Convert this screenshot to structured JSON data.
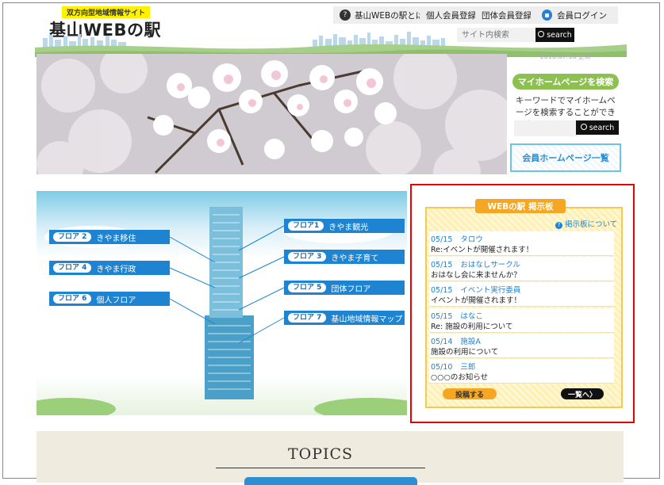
{
  "header": {
    "tagline": "双方向型地域情報サイト",
    "logo": "基山WEBの駅",
    "nav": {
      "about": "基山WEBの駅とは",
      "personal": "個人会員登録",
      "group": "団体会員登録",
      "login": "会員ログイン"
    },
    "search": {
      "placeholder": "サイト内検索",
      "button": "search"
    }
  },
  "sidebar": {
    "date": "2018.07.16 更新",
    "mypage_title": "マイホームページを検索",
    "mypage_desc": "キーワードでマイホームページを検索することができます",
    "mypage_button": "search",
    "member_list": "会員ホームページ一覧"
  },
  "floors": [
    {
      "tag": "フロア 2",
      "label": "きやま移住"
    },
    {
      "tag": "フロア 4",
      "label": "きやま行政"
    },
    {
      "tag": "フロア 6",
      "label": "個人フロア"
    },
    {
      "tag": "フロア1",
      "label": "きやま観光"
    },
    {
      "tag": "フロア 3",
      "label": "きやま子育て"
    },
    {
      "tag": "フロア 5",
      "label": "団体フロア"
    },
    {
      "tag": "フロア 7",
      "label": "基山地域情報マップ"
    }
  ],
  "board": {
    "title": "WEBの駅 掲示板",
    "about": "掲示板について",
    "posts": [
      {
        "date": "05/15",
        "author": "タロウ",
        "text": "Re:イベントが開催されます！"
      },
      {
        "date": "05/15",
        "author": "おはなしサークル",
        "text": "おはなし会に来ませんか？"
      },
      {
        "date": "05/15",
        "author": "イベント実行委員",
        "text": "イベントが開催されます！"
      },
      {
        "date": "05/15",
        "author": "はなこ",
        "text": "Re: 施設の利用について"
      },
      {
        "date": "05/14",
        "author": "施設A",
        "text": "施設の利用について"
      },
      {
        "date": "05/10",
        "author": "三郎",
        "text": "○○○のお知らせ"
      }
    ],
    "post_button": "投稿する",
    "list_button": "一覧へ〉"
  },
  "topics": {
    "title": "TOPICS"
  },
  "colors": {
    "accent_blue": "#1e84d2",
    "accent_green": "#8cc152",
    "accent_orange": "#f5a623",
    "highlight_red": "#ee0000"
  }
}
